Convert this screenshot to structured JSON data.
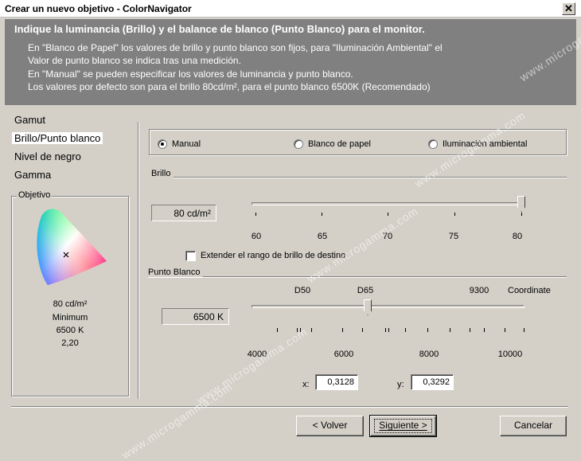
{
  "window": {
    "title": "Crear un nuevo objetivo - ColorNavigator",
    "close_glyph": "✕"
  },
  "header": {
    "title": "Indique la luminancia (Brillo) y el balance de blanco (Punto Blanco) para el monitor.",
    "lines": [
      "En \"Blanco de Papel\" los valores de brillo y punto blanco son fijos, para \"Iluminación Ambiental\" el",
      "Valor de punto blanco se indica tras una medición.",
      "En \"Manual\" se pueden especificar los valores de luminancia y punto blanco.",
      "Los valores por defecto son  para el brillo 80cd/m², para el punto blanco 6500K (Recomendado)"
    ]
  },
  "nav": {
    "items": [
      "Gamut",
      "Brillo/Punto blanco",
      "Nivel de negro",
      "Gamma"
    ],
    "selected_index": 1
  },
  "objetivo": {
    "label": "Objetivo",
    "lines": [
      "80 cd/m²",
      "Minimum",
      "6500 K",
      "2,20"
    ]
  },
  "mode": {
    "options": [
      "Manual",
      "Blanco de papel",
      "Iluminación ambiental"
    ],
    "selected": "Manual"
  },
  "brillo": {
    "label": "Brillo",
    "value_text": "80 cd/m²",
    "slider_value": 80,
    "min": 58,
    "max": 80,
    "tick_labels": [
      "60",
      "65",
      "70",
      "75",
      "80"
    ],
    "extend_label": "Extender el rango de brillo de destino",
    "extend_checked": false
  },
  "punto_blanco": {
    "label": "Punto Blanco",
    "value_text": "6500 K",
    "slider_value": 6500,
    "min": 4000,
    "max": 10000,
    "top_labels": [
      "D50",
      "D65",
      "9300",
      "Coordinate"
    ],
    "tick_labels": [
      "4000",
      "6000",
      "8000",
      "10000"
    ],
    "x_label": "x:",
    "x_value": "0,3128",
    "y_label": "y:",
    "y_value": "0,3292"
  },
  "buttons": {
    "back": "< Volver",
    "next": "Siguiente >",
    "cancel": "Cancelar"
  },
  "watermark": "www.microgamma.com",
  "colors": {
    "header_bg": "#808080",
    "dialog_bg": "#d4d0c8"
  }
}
